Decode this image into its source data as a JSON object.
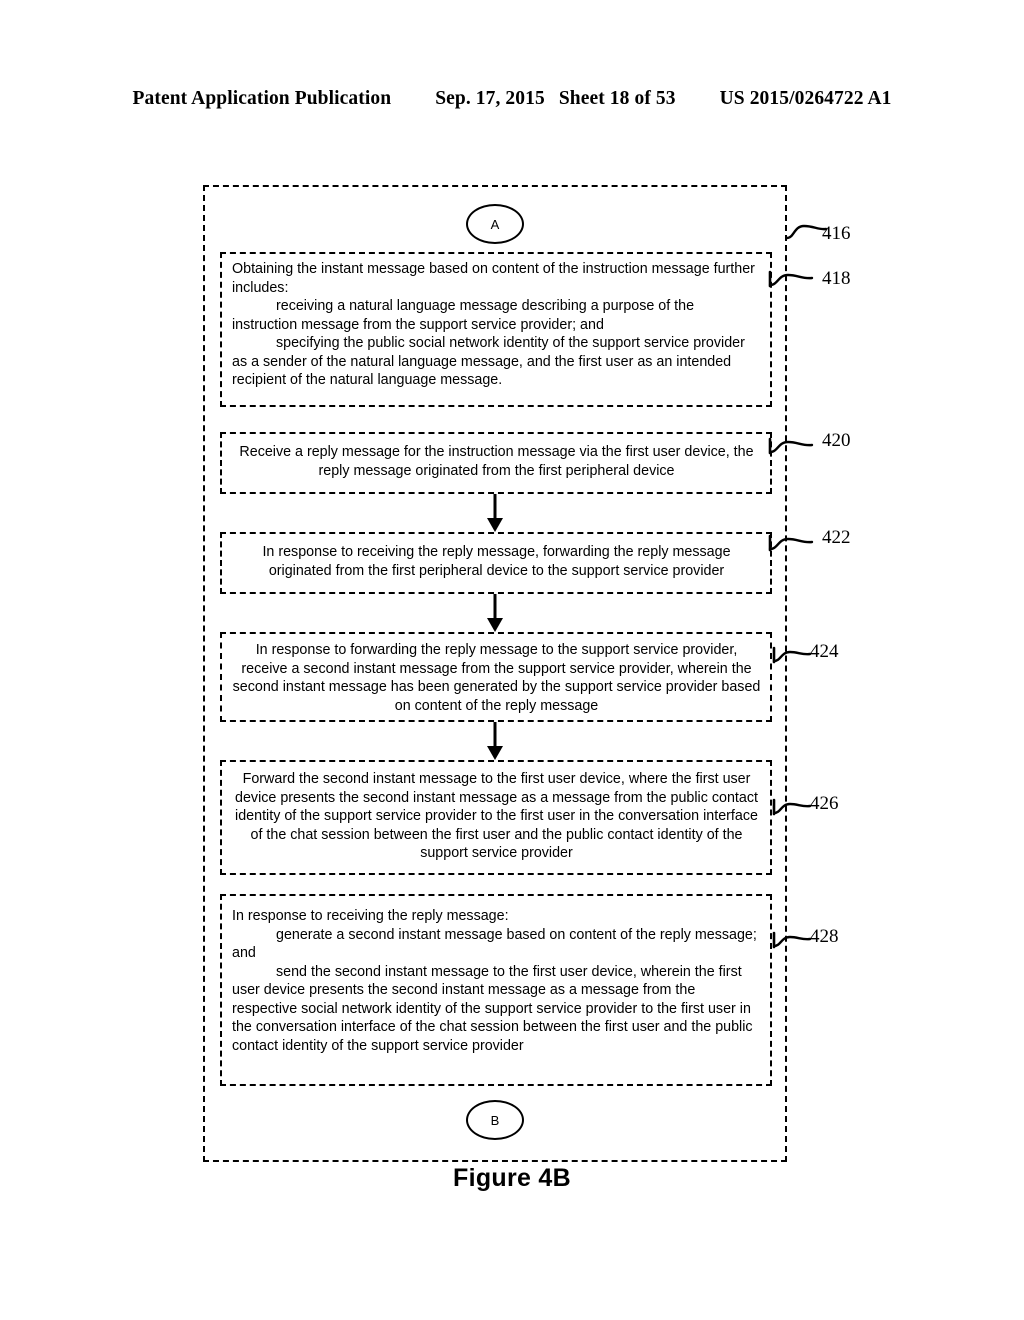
{
  "header": {
    "publication": "Patent Application Publication",
    "date": "Sep. 17, 2015",
    "sheet": "Sheet 18 of 53",
    "doc_number": "US 2015/0264722 A1"
  },
  "figure": {
    "caption": "Figure 4B",
    "outer_ref": "416",
    "connector_top": "A",
    "connector_bottom": "B"
  },
  "steps": [
    {
      "ref": "418",
      "align": "left",
      "lines": [
        {
          "indent": false,
          "text": "Obtaining the instant message based on content of the instruction message further includes:"
        },
        {
          "indent": true,
          "text": "receiving a natural language message describing a purpose of the instruction message from the support service provider; and"
        },
        {
          "indent": true,
          "text": "specifying the public social network identity of the support service provider as a sender of the natural language message, and the first user as an intended recipient of the natural language message."
        }
      ]
    },
    {
      "ref": "420",
      "align": "center",
      "lines": [
        {
          "indent": false,
          "text": "Receive a reply message for the instruction message via the first user device, the reply message originated from the first peripheral device"
        }
      ]
    },
    {
      "ref": "422",
      "align": "center",
      "lines": [
        {
          "indent": false,
          "text": "In response to receiving the reply message, forwarding the reply message originated from the first peripheral device to the support service provider"
        }
      ]
    },
    {
      "ref": "424",
      "align": "center",
      "lines": [
        {
          "indent": false,
          "text": "In response to forwarding the reply message to the support service provider, receive a second instant message from the support service provider, wherein the second instant message has been generated by the support service provider based on content of the reply message"
        }
      ]
    },
    {
      "ref": "426",
      "align": "center",
      "lines": [
        {
          "indent": false,
          "text": "Forward the second instant message to the first user device, where the first user device presents the second instant message as a message from the public contact identity of the support service provider to the first user in the conversation interface of the chat session between the first user and the public contact identity of the support service provider"
        }
      ]
    },
    {
      "ref": "428",
      "align": "left",
      "lines": [
        {
          "indent": false,
          "text": "In response to receiving the reply message:"
        },
        {
          "indent": true,
          "text": "generate a second instant message based on content of the reply message; and"
        },
        {
          "indent": true,
          "text": "send the second instant message to the first user device, wherein the first user device presents the second instant message as a message from the respective social network identity of the support service provider to the first user in the conversation interface of the chat session between the first user and the public contact identity of the support service provider"
        }
      ]
    }
  ]
}
